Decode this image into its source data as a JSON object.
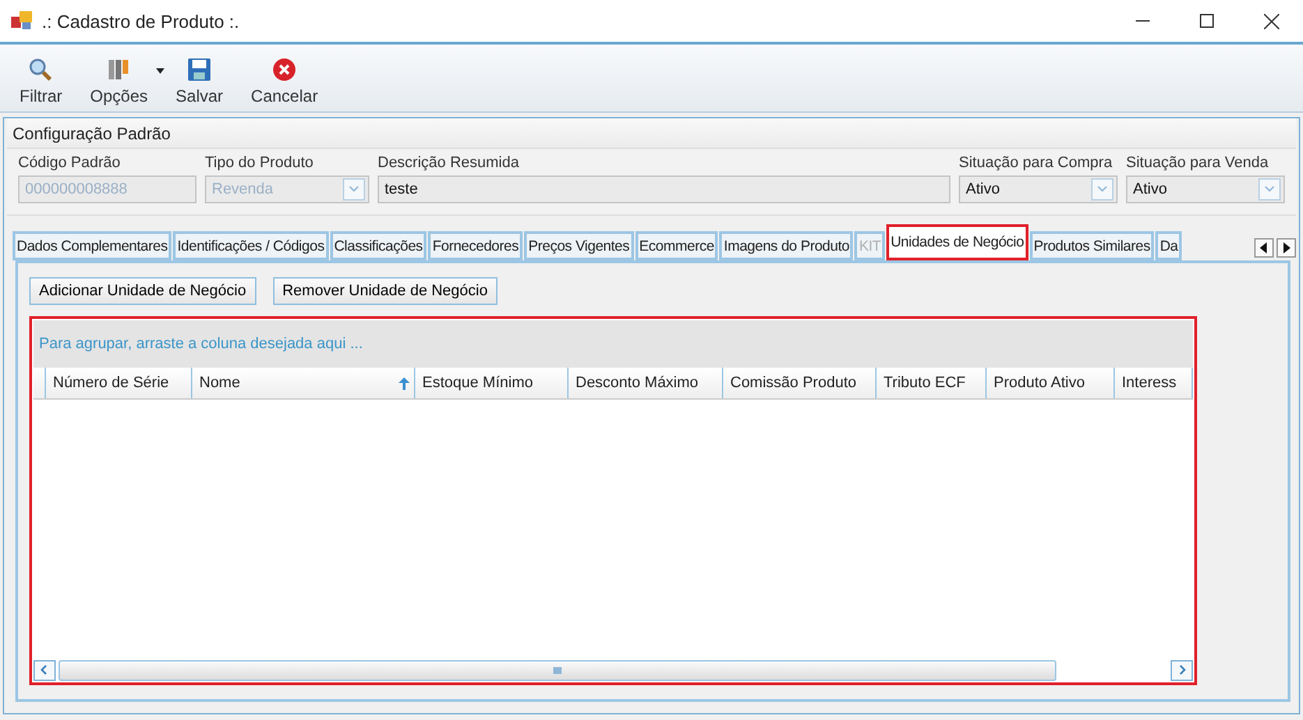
{
  "window": {
    "title": ".: Cadastro de Produto :."
  },
  "toolbar": [
    {
      "label": "Filtrar",
      "kind": "search",
      "dropdown": false
    },
    {
      "label": "Opções",
      "kind": "tools",
      "dropdown": true
    },
    {
      "label": "Salvar",
      "kind": "save",
      "dropdown": false
    },
    {
      "label": "Cancelar",
      "kind": "cancel",
      "dropdown": false
    }
  ],
  "config": {
    "title": "Configuração Padrão",
    "fields": [
      {
        "label": "Código Padrão",
        "value": "000000008888",
        "kind": "text",
        "disabled": true
      },
      {
        "label": "Tipo do Produto",
        "value": "Revenda",
        "kind": "combo",
        "disabled": true
      },
      {
        "label": "Descrição Resumida",
        "value": "teste",
        "kind": "text",
        "disabled": false
      },
      {
        "label": "Situação para Compra",
        "value": "Ativo",
        "kind": "combo",
        "disabled": false
      },
      {
        "label": "Situação para Venda",
        "value": "Ativo",
        "kind": "combo",
        "disabled": false
      }
    ]
  },
  "tabs": [
    {
      "label": "Dados Complementares",
      "selected": false,
      "disabled": false
    },
    {
      "label": "Identificações / Códigos",
      "selected": false,
      "disabled": false
    },
    {
      "label": "Classificações",
      "selected": false,
      "disabled": false
    },
    {
      "label": "Fornecedores",
      "selected": false,
      "disabled": false
    },
    {
      "label": "Preços Vigentes",
      "selected": false,
      "disabled": false
    },
    {
      "label": "Ecommerce",
      "selected": false,
      "disabled": false
    },
    {
      "label": "Imagens do Produto",
      "selected": false,
      "disabled": false
    },
    {
      "label": "KIT",
      "selected": false,
      "disabled": true
    },
    {
      "label": "Unidades de Negócio",
      "selected": true,
      "disabled": false
    },
    {
      "label": "Produtos Similares",
      "selected": false,
      "disabled": false
    },
    {
      "label": "Da",
      "selected": false,
      "disabled": false
    }
  ],
  "buttons": [
    "Adicionar Unidade de Negócio",
    "Remover Unidade de Negócio"
  ],
  "grid": {
    "highlighted": true,
    "group_hint": "Para agrupar, arraste a coluna desejada aqui ...",
    "columns": [
      {
        "label": "Número de Série",
        "sorted": false
      },
      {
        "label": "Nome",
        "sorted": true
      },
      {
        "label": "Estoque Mínimo",
        "sorted": false
      },
      {
        "label": "Desconto Máximo",
        "sorted": false
      },
      {
        "label": "Comissão Produto",
        "sorted": false
      },
      {
        "label": "Tributo ECF",
        "sorted": false
      },
      {
        "label": "Produto Ativo",
        "sorted": false
      },
      {
        "label": "Interess",
        "sorted": false
      }
    ]
  }
}
